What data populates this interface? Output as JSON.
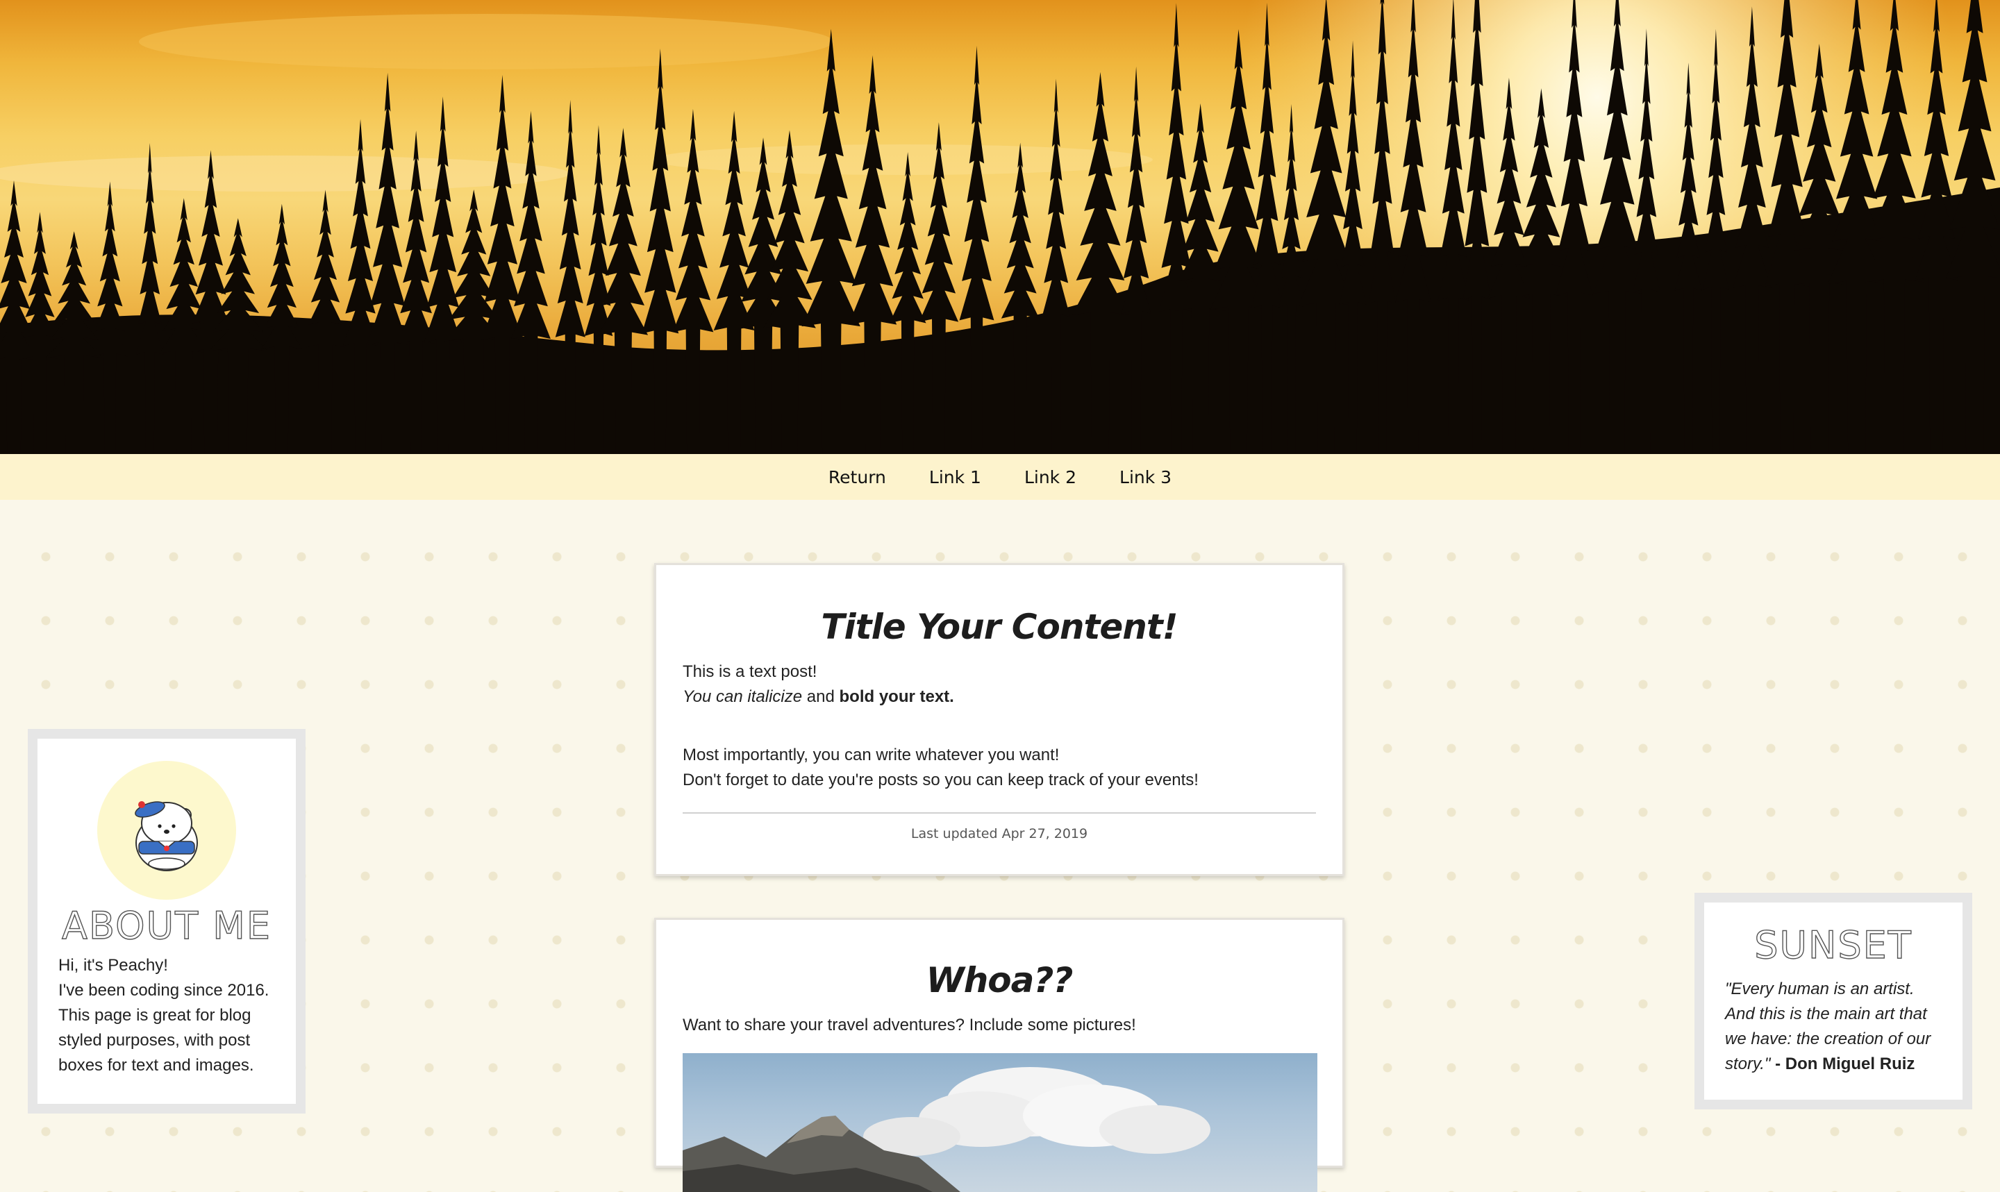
{
  "nav": {
    "items": [
      "Return",
      "Link 1",
      "Link 2",
      "Link 3"
    ]
  },
  "posts": [
    {
      "title": "Title Your Content!",
      "line1": "This is a text post!",
      "italic_text": "You can italicize",
      "and_text": " and ",
      "bold_text": "bold your text.",
      "line3": "Most importantly, you can write whatever you want!",
      "line4": "Don't forget to date you're posts so you can keep track of your events!",
      "updated": "Last updated Apr 27, 2019"
    },
    {
      "title": "Whoa??",
      "body": "Want to share your travel adventures? Include some pictures!"
    }
  ],
  "about": {
    "heading": "ABOUT ME",
    "lines": [
      "Hi, it's Peachy!",
      "I've been coding since 2016.",
      "This page is great for blog",
      "styled purposes, with post",
      "boxes for text and images."
    ]
  },
  "sunset": {
    "heading": "SUNSET",
    "quote_lines": [
      "\"Every human is an artist.",
      "And this is the main art that",
      "we have: the creation of our",
      "story.\""
    ],
    "author": " - Don Miguel Ruiz"
  },
  "colors": {
    "background": "#faf7ea",
    "nav": "#fdf3cd",
    "avatar_circle": "#fdf8cd"
  }
}
